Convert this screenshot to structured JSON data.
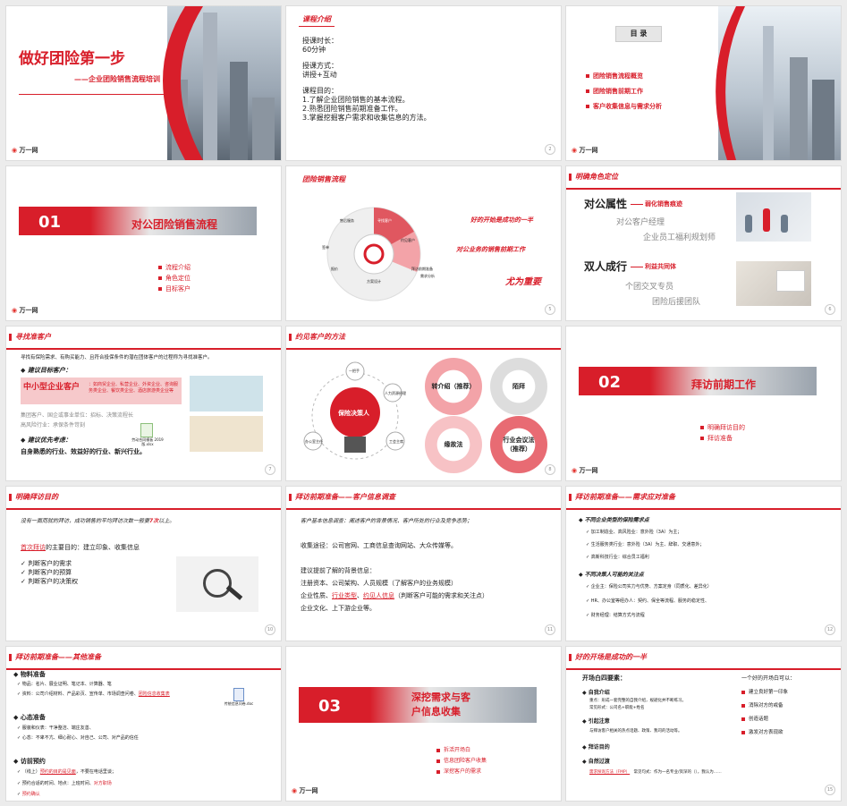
{
  "brand": {
    "logo_text": "万一网",
    "accent": "#d81e2a"
  },
  "s1": {
    "title": "做好团险第一步",
    "subtitle": "——企业团险销售流程培训",
    "page": ""
  },
  "s2": {
    "title": "课程介绍",
    "dur_label": "授课时长：",
    "dur_value": "60分钟",
    "mode_label": "授课方式：",
    "mode_value": "讲授+互动",
    "goal_label": "课程目的：",
    "goals": [
      "1.了解企业团险销售的基本流程。",
      "2.熟悉团险销售前期准备工作。",
      "3.掌握挖掘客户需求和收集信息的方法。"
    ],
    "page": "2"
  },
  "s3": {
    "title": "目 录",
    "items": [
      "团险销售流程概览",
      "团险销售前期工作",
      "客户收集信息与需求分析"
    ],
    "page": "3"
  },
  "s4": {
    "num": "01",
    "title": "对公团险销售流程",
    "items": [
      "流程介绍",
      "角色定位",
      "目标客户"
    ],
    "page": ""
  },
  "s5": {
    "title": "团险销售流程",
    "stages": [
      "寻找客户",
      "约见客户",
      "拜访前期准备",
      "需求分析",
      "方案设计",
      "报价",
      "签单",
      "售后服务"
    ],
    "quote1": "好的开始是成功的一半",
    "quote2": "对公业务的销售前期工作",
    "quote3": "尤为重要",
    "page": "5"
  },
  "s6": {
    "title": "明确角色定位",
    "h1": "对公属性",
    "h1_tag": "弱化销售痕迹",
    "r1a": "对公客户经理",
    "r1b": "企业员工福利规划师",
    "h2": "双人成行",
    "h2_tag": "利益共同体",
    "r2a": "个团交叉专员",
    "r2b": "团险后援团队",
    "page": "6"
  },
  "s7": {
    "title": "寻找准客户",
    "intro": "寻找有保险需求、有购买能力、且符合投保条件的潜在团体客户的过程称为寻找准客户。",
    "sub1": "建议目标客户：",
    "box_title": "中小型企业客户",
    "box_text": "：如商贸企业、私营企业、外资企业、咨询服务类企业、餐饮类企业、酒店旅游类企业等",
    "grey": "集团客户、国企或事业单位：招标、决策流程长",
    "grey2": "高风险行业：承保条件苛刻",
    "sub2": "建议优先考虑：",
    "pref": "自身熟悉的行业、效益好的行业、新兴行业。",
    "file": "劳动合同模板 2019版.xlsx",
    "page": "7"
  },
  "s8": {
    "title": "约见客户的方法",
    "center": "保险决策人",
    "nodes": [
      "一把手",
      "人力资源经理",
      "工会主席",
      "办公室主任"
    ],
    "methods": [
      "转介绍（推荐）",
      "陌拜",
      "缘故法",
      "行业会议法（推荐）"
    ],
    "page": "8"
  },
  "s9": {
    "num": "02",
    "title": "拜访前期工作",
    "items": [
      "明确拜访目的",
      "拜访准备"
    ],
    "page": ""
  },
  "s10": {
    "title": "明确拜访目的",
    "line1": "没有一面而就的拜访，成功销售的平均拜访次数一般要",
    "line1_hl": "7次",
    "line1_end": "以上。",
    "sub_a": "首次拜访",
    "sub_b": "的主要目的：建立印象、收集信息",
    "items": [
      "判断客户的需求",
      "判断客户的预算",
      "判断客户的决策权"
    ],
    "page": "10"
  },
  "s11": {
    "title": "拜访前期准备——客户信息调查",
    "l1": "客户基本信息调查：阐述客户的背景情况、客户所处的行业及竞争态势；",
    "l2": "收集途径：公司官网、工商信息查询网站、大众传媒等。",
    "l3": "建议提前了解的背景信息：",
    "l4": "注册资本、公司架构、人员规模（了解客户的业务规模）",
    "l5a": "企业性质、",
    "l5b": "行业类型",
    "l5c": "、",
    "l5d": "约见人信息",
    "l5e": "（判断客户可能的需求和关注点）",
    "l6": "企业文化、上下游企业等。",
    "page": "11"
  },
  "s12": {
    "title": "拜访前期准备——需求应对准备",
    "h1": "不同企业类型的保险需求点",
    "a": [
      "加工制造业、高风险业：意外险（3A）为主；",
      "生活服务类行业：意外险（3A）为主、辞职、交通意外；",
      "高新科技行业：综合员工福利"
    ],
    "h2": "不同决策人可能的关注点",
    "b": [
      "企业主：保险公司实力与优势、方案定身（同质化、差异化）",
      "HR、办公室等经办人：契约、保全等流程、服务的稳定性、",
      "财务经理：结算方式与流程"
    ],
    "page": "12"
  },
  "s13": {
    "title": "拜访前期准备——其他准备",
    "h1": "物料准备",
    "m1": "物品：名片、展业证明、笔记本、计算器、笔",
    "m2a": "资料：公司介绍材料、产品彩页、宣传单、市场调查问卷、",
    "m2b": "团险信息收集表",
    "file": "传统信息问卷.doc",
    "h2": "心态准备",
    "p1": "服装和仪表：干净整洁、端庄友善、",
    "p2": "心态：不卑不亢、细心耐心、对自己、公司、对产品的信任",
    "h3": "访前预约",
    "v1a": "（线上）",
    "v1b": "预约的目的是见面",
    "v1c": "，不要在电话里谈；",
    "v2a": "预约合适的时间、地点：上班时间、",
    "v2b": "对方职场",
    "v3": "预约确认",
    "page": ""
  },
  "s14": {
    "num": "03",
    "title": "深挖需求与客户信息收集",
    "items": [
      "拆活开场白",
      "信息团险客户收集",
      "深挖客户的需求"
    ],
    "page": ""
  },
  "s15": {
    "title": "好的开场是成功的一半",
    "h": "开场白四要素：",
    "e1": "自我介绍",
    "e1a": "重点：形成一套完整的自我介绍，规避化并不断练习。",
    "e1b": "常见形式：公司名+职能+姓名",
    "e2": "引起注意",
    "e2a": "与拜访客户相关的热点话题、政策、我司的活动等。",
    "e3": "拜访目的",
    "e4": "自然过渡",
    "e4a": "需求探询方法（FMP）",
    "e4b": "常见句式：作为一名专业/资深的（），我认为……",
    "right_h": "一个好的开场白可以：",
    "r": [
      "建立良好第一印象",
      "消除对方的戒备",
      "创造话题",
      "激发对方表现欲"
    ],
    "page": "15"
  }
}
